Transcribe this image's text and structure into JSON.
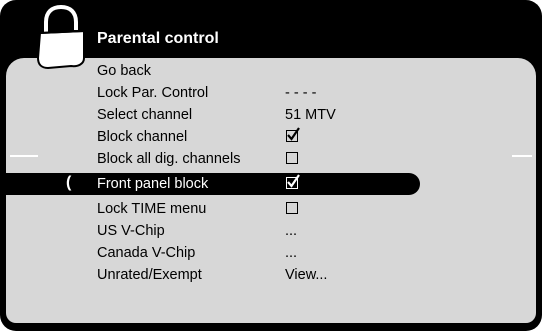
{
  "menu": {
    "title": "Parental control",
    "items": [
      {
        "label": "Go back",
        "value": ""
      },
      {
        "label": "Lock Par. Control",
        "value": "- - - -"
      },
      {
        "label": "Select channel",
        "value": "51 MTV"
      },
      {
        "label": "Block channel",
        "checkbox": true
      },
      {
        "label": "Block all dig. channels",
        "checkbox": false
      },
      {
        "label": "Front panel block",
        "checkbox": true,
        "selected": true,
        "cursor": "("
      },
      {
        "label": "Lock TIME menu",
        "checkbox": false
      },
      {
        "label": "US V-Chip",
        "value": "..."
      },
      {
        "label": "Canada V-Chip",
        "value": "..."
      },
      {
        "label": "Unrated/Exempt",
        "value": "View..."
      }
    ]
  }
}
